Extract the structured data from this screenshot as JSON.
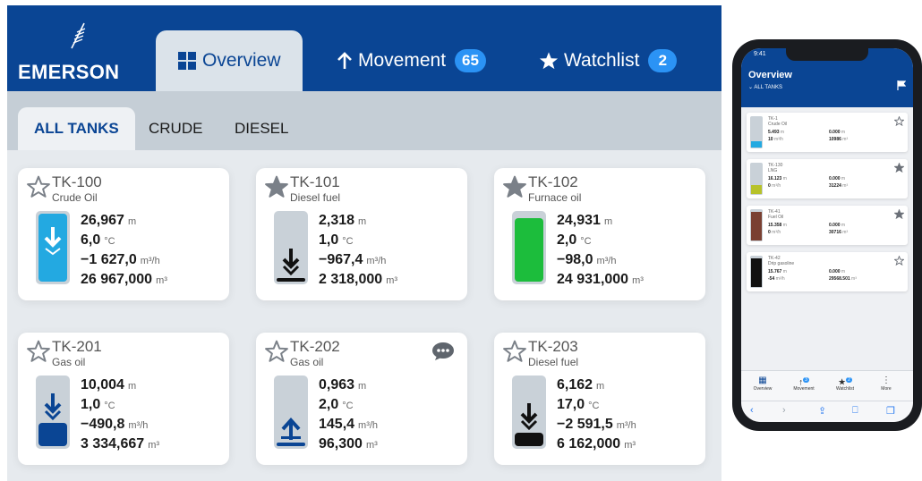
{
  "brand": {
    "name": "EMERSON"
  },
  "nav": {
    "tabs": [
      {
        "label": "Overview",
        "icon": "grid-icon",
        "active": true
      },
      {
        "label": "Movement",
        "icon": "arrow-up-icon",
        "badge": "65"
      },
      {
        "label": "Watchlist",
        "icon": "star-icon",
        "badge": "2"
      }
    ]
  },
  "filters": {
    "tabs": [
      {
        "label": "ALL TANKS",
        "active": true
      },
      {
        "label": "CRUDE"
      },
      {
        "label": "DIESEL"
      }
    ]
  },
  "colors": {
    "header": "#0a4594",
    "badge": "#2b93f5",
    "crude_fill": "#23a9e1",
    "furnace_fill": "#1cbd3c",
    "gas_fill": "#0a4594",
    "diesel_fill": "#111111",
    "lpg_fill": "#b7c22a",
    "fuel_fill": "#7a4032"
  },
  "tanks": [
    {
      "id": "TK-100",
      "product": "Crude Oil",
      "watched": false,
      "level": "26,967",
      "level_unit": "m",
      "temp": "6,0",
      "temp_unit": "°C",
      "flow": "−1 627,0",
      "flow_unit": "m³/h",
      "volume": "26 967,000",
      "volume_unit": "m³",
      "fill_fraction": 1.0,
      "direction": "down"
    },
    {
      "id": "TK-101",
      "product": "Diesel fuel",
      "watched": true,
      "level": "2,318",
      "level_unit": "m",
      "temp": "1,0",
      "temp_unit": "°C",
      "flow": "−967,4",
      "flow_unit": "m³/h",
      "volume": "2 318,000",
      "volume_unit": "m³",
      "fill_fraction": 0.04,
      "direction": "down"
    },
    {
      "id": "TK-102",
      "product": "Furnace oil",
      "watched": true,
      "level": "24,931",
      "level_unit": "m",
      "temp": "2,0",
      "temp_unit": "°C",
      "flow": "−98,0",
      "flow_unit": "m³/h",
      "volume": "24 931,000",
      "volume_unit": "m³",
      "fill_fraction": 0.93,
      "direction": "none"
    },
    {
      "id": "TK-201",
      "product": "Gas oil",
      "watched": false,
      "level": "10,004",
      "level_unit": "m",
      "temp": "1,0",
      "temp_unit": "°C",
      "flow": "−490,8",
      "flow_unit": "m³/h",
      "volume": "3 334,667",
      "volume_unit": "m³",
      "fill_fraction": 0.34,
      "direction": "down"
    },
    {
      "id": "TK-202",
      "product": "Gas oil",
      "watched": false,
      "level": "0,963",
      "level_unit": "m",
      "temp": "2,0",
      "temp_unit": "°C",
      "flow": "145,4",
      "flow_unit": "m³/h",
      "volume": "96,300",
      "volume_unit": "m³",
      "fill_fraction": 0.02,
      "direction": "up",
      "has_comment": true
    },
    {
      "id": "TK-203",
      "product": "Diesel fuel",
      "watched": false,
      "level": "6,162",
      "level_unit": "m",
      "temp": "17,0",
      "temp_unit": "°C",
      "flow": "−2 591,5",
      "flow_unit": "m³/h",
      "volume": "6 162,000",
      "volume_unit": "m³",
      "fill_fraction": 0.2,
      "direction": "down"
    }
  ],
  "phone": {
    "time": "9:41",
    "title": "Overview",
    "filter": "ALL TANKS",
    "tanks": [
      {
        "id": "TK-1",
        "product": "Crude Oil",
        "v1": "5.493",
        "v1u": "m",
        "v2": "0.000",
        "v2u": "m",
        "v3": "10",
        "v3u": "m³/h",
        "v4": "10986",
        "v4u": "m³",
        "watched": false,
        "fill_fraction": 0.2,
        "color": "crude_fill"
      },
      {
        "id": "TK-130",
        "product": "LNG",
        "v1": "16.123",
        "v1u": "m",
        "v2": "0.000",
        "v2u": "m",
        "v3": "0",
        "v3u": "m³/h",
        "v4": "31224",
        "v4u": "m³",
        "watched": true,
        "fill_fraction": 0.3,
        "color": "lpg_fill"
      },
      {
        "id": "TK-41",
        "product": "Fuel Oil",
        "v1": "15.358",
        "v1u": "m",
        "v2": "0.000",
        "v2u": "m",
        "v3": "0",
        "v3u": "m³/h",
        "v4": "30716",
        "v4u": "m³",
        "watched": true,
        "fill_fraction": 0.95,
        "color": "fuel_fill"
      },
      {
        "id": "TK-42",
        "product": "Drip gasoline",
        "v1": "15.767",
        "v1u": "m",
        "v2": "0.000",
        "v2u": "m",
        "v3": "-54",
        "v3u": "m³/h",
        "v4": "29568.501",
        "v4u": "m³",
        "watched": false,
        "fill_fraction": 0.95,
        "color": "diesel_fill"
      }
    ],
    "nav": [
      {
        "label": "Overview",
        "icon": "grid-icon"
      },
      {
        "label": "Movement",
        "icon": "arrow-up-icon",
        "badge": "3"
      },
      {
        "label": "Watchlist",
        "icon": "star-icon",
        "badge": "2"
      },
      {
        "label": "More",
        "icon": "more-icon"
      }
    ]
  }
}
